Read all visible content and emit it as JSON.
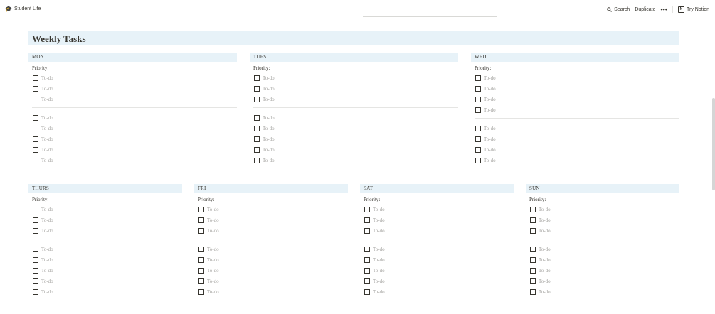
{
  "topbar": {
    "breadcrumb_icon": "🎓",
    "breadcrumb": "Student Life",
    "search_label": "Search",
    "duplicate_label": "Duplicate",
    "more_label": "•••",
    "try_label": "Try Notion",
    "try_icon": "N"
  },
  "page": {
    "title": "Weekly Tasks"
  },
  "days": [
    {
      "name": "MON",
      "priority": "Priority:",
      "priority_todos": [
        "To-do",
        "To-do",
        "To-do"
      ],
      "todos": [
        "To-do",
        "To-do",
        "To-do",
        "To-do",
        "To-do"
      ]
    },
    {
      "name": "TUES",
      "priority": "Priority:",
      "priority_todos": [
        "To-do",
        "To-do",
        "To-do"
      ],
      "todos": [
        "To-do",
        "To-do",
        "To-do",
        "To-do",
        "To-do"
      ]
    },
    {
      "name": "WED",
      "priority": "Priority:",
      "priority_todos": [
        "To-do",
        "To-do",
        "To-do",
        "To-do"
      ],
      "todos": [
        "To-do",
        "To-do",
        "To-do",
        "To-do"
      ]
    },
    {
      "name": "THURS",
      "priority": "Priority:",
      "priority_todos": [
        "To-do",
        "To-do",
        "To-do"
      ],
      "todos": [
        "To-do",
        "To-do",
        "To-do",
        "To-do",
        "To-do"
      ]
    },
    {
      "name": "FRI",
      "priority": "Priority:",
      "priority_todos": [
        "To-do",
        "To-do",
        "To-do"
      ],
      "todos": [
        "To-do",
        "To-do",
        "To-do",
        "To-do",
        "To-do"
      ]
    },
    {
      "name": "SAT",
      "priority": "Priority:",
      "priority_todos": [
        "To-do",
        "To-do",
        "To-do"
      ],
      "todos": [
        "To-do",
        "To-do",
        "To-do",
        "To-do",
        "To-do"
      ]
    },
    {
      "name": "SUN",
      "priority": "Priority:",
      "priority_todos": [
        "To-do",
        "To-do",
        "To-do"
      ],
      "todos": [
        "To-do",
        "To-do",
        "To-do",
        "To-do",
        "To-do"
      ]
    }
  ]
}
